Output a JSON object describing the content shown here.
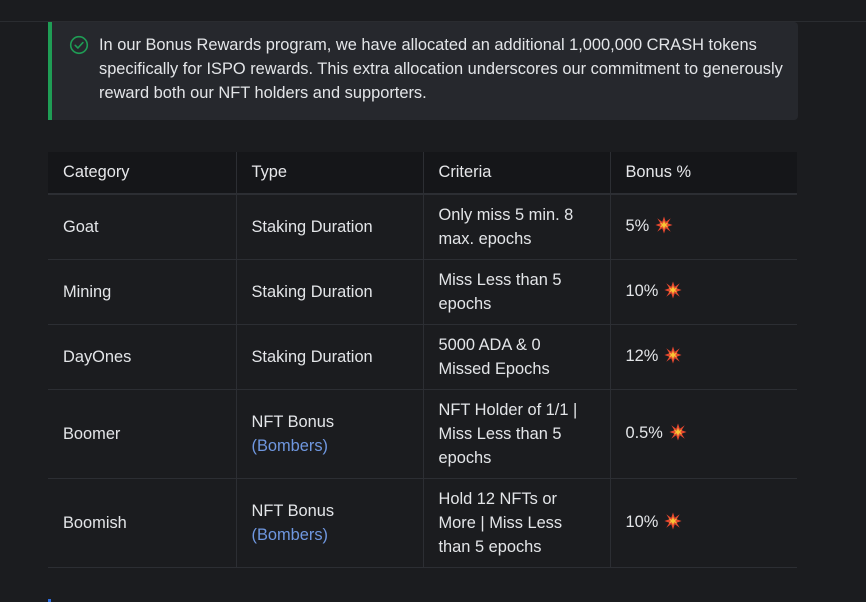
{
  "hint": {
    "icon": "check-circle-icon",
    "accent_color": "#1f9d55",
    "text": "In our Bonus Rewards program, we have allocated an additional 1,000,000 CRASH tokens specifically for ISPO rewards. This extra allocation underscores our commitment to generously reward both our NFT holders and supporters."
  },
  "table": {
    "headers": [
      "Category",
      "Type",
      "Criteria",
      "Bonus %"
    ],
    "rows": [
      {
        "category": "Goat",
        "type": "Staking Duration",
        "type_link": "",
        "criteria": "Only miss 5 min. 8 max. epochs",
        "bonus": "5%",
        "icon": "collision-icon"
      },
      {
        "category": "Mining",
        "type": "Staking Duration",
        "type_link": "",
        "criteria": "Miss Less than 5 epochs",
        "bonus": "10%",
        "icon": "collision-icon"
      },
      {
        "category": "DayOnes",
        "type": "Staking Duration",
        "type_link": "",
        "criteria": "5000 ADA & 0 Missed Epochs",
        "bonus": "12%",
        "icon": "collision-icon"
      },
      {
        "category": "Boomer",
        "type": "NFT Bonus",
        "type_link": "(Bombers)",
        "criteria": "NFT Holder of 1/1 | Miss Less than 5 epochs",
        "bonus": "0.5%",
        "icon": "collision-icon"
      },
      {
        "category": "Boomish",
        "type": "NFT Bonus",
        "type_link": "(Bombers)",
        "criteria": "Hold 12 NFTs or More | Miss Less than 5 epochs",
        "bonus": "10%",
        "icon": "collision-icon"
      }
    ]
  },
  "colors": {
    "background": "#1b1c1f",
    "link": "#6f97e0",
    "hint_background": "#26282d"
  }
}
